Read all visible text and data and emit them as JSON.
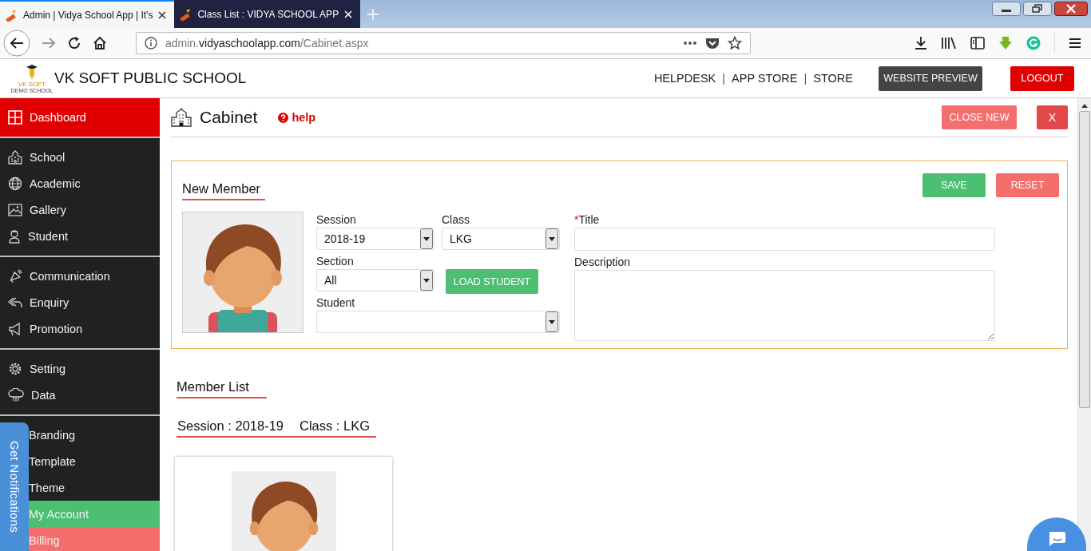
{
  "browser": {
    "tabs": [
      {
        "title": "Admin | Vidya School App | It's",
        "selected": true
      },
      {
        "title": "Class List : VIDYA SCHOOL APP",
        "selected": false
      }
    ],
    "url": {
      "subdomain": "admin.",
      "domain": "vidyaschoolapp.com",
      "path": "/Cabinet.aspx"
    }
  },
  "app_header": {
    "logo_lines": [
      "VK SOFT",
      "DEMO SCHOOL"
    ],
    "school_name": "VK SOFT PUBLIC SCHOOL",
    "nav": [
      {
        "kind": "link",
        "text": "HELPDESK"
      },
      {
        "kind": "separator",
        "text": "|"
      },
      {
        "kind": "link",
        "text": "APP STORE"
      },
      {
        "kind": "separator",
        "text": "|"
      },
      {
        "kind": "link",
        "text": "STORE"
      }
    ],
    "buttons": [
      {
        "kind": "dark",
        "label": "WEBSITE PREVIEW"
      },
      {
        "kind": "danger",
        "label": "LOGOUT"
      }
    ]
  },
  "sidebar": {
    "top": {
      "label": "Dashboard",
      "selected": true,
      "color": "#e00000"
    },
    "groups": [
      [
        {
          "label": "School",
          "selected": false
        },
        {
          "label": "Academic",
          "selected": false
        },
        {
          "label": "Gallery",
          "selected": false
        },
        {
          "label": "Student",
          "selected": false
        }
      ],
      [
        {
          "label": "Communication",
          "selected": false
        },
        {
          "label": "Enquiry",
          "selected": false
        },
        {
          "label": "Promotion",
          "selected": false
        }
      ],
      [
        {
          "label": "Setting",
          "selected": false
        },
        {
          "label": "Data",
          "selected": false
        }
      ],
      [
        {
          "label": "Branding",
          "selected": false
        },
        {
          "label": "Template",
          "selected": false
        },
        {
          "label": "Theme",
          "selected": false
        },
        {
          "label": "My Account",
          "selected": false,
          "color": "#4cbf73"
        },
        {
          "label": "Billing",
          "selected": false,
          "color": "#f56e6e"
        }
      ]
    ]
  },
  "notifications_tab": {
    "label": "Get Notifications"
  },
  "page": {
    "title": "Cabinet",
    "help": "help",
    "buttons": [
      {
        "kind": "light-danger",
        "label": "CLOSE NEW"
      },
      {
        "kind": "danger-dark",
        "label": "X"
      }
    ]
  },
  "new_member": {
    "heading": "New Member",
    "buttons": [
      {
        "kind": "success",
        "label": "SAVE"
      },
      {
        "kind": "light-danger",
        "label": "RESET"
      }
    ],
    "session": {
      "label": "Session",
      "value": "2018-19"
    },
    "class": {
      "label": "Class",
      "value": "LKG"
    },
    "section": {
      "label": "Section",
      "value": "All"
    },
    "load_button": "LOAD STUDENT",
    "student": {
      "label": "Student"
    },
    "title": {
      "label": "Title",
      "required_mark": "*"
    },
    "description": {
      "label": "Description"
    }
  },
  "member_list": {
    "heading": "Member List",
    "group": {
      "session": "Session : 2018-19",
      "class": "Class : LKG"
    }
  }
}
